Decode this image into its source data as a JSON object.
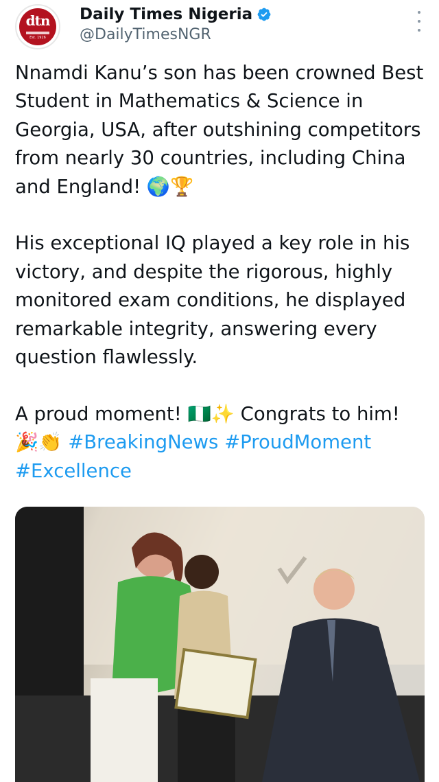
{
  "author": {
    "display_name": "Daily Times Nigeria",
    "handle": "@DailyTimesNGR",
    "avatar_mark": "dtn",
    "avatar_small_text": "Est. 1926",
    "verified_icon": "verified-badge-icon"
  },
  "tweet": {
    "paragraph_1": "Nnamdi Kanu’s son has been crowned Best Student in Mathematics & Science in Georgia, USA, after outshining competitors from nearly 30 countries, including China and England! 🌍🏆",
    "paragraph_2": "His exceptional IQ played a key role in his victory, and despite the rigorous, highly monitored exam conditions, he displayed remarkable integrity, answering every question flawlessly.",
    "paragraph_3_text": "A proud moment! 🇳🇬✨ Congrats to him! 🎉👏 ",
    "hashtags": [
      "#BreakingNews",
      "#ProudMoment",
      "#Excellence"
    ]
  },
  "media": {
    "type": "photo",
    "description_icon": "award-ceremony-photo"
  },
  "colors": {
    "link": "#1d9bf0",
    "text": "#0f1419",
    "secondary": "#536471",
    "verified": "#1d9bf0",
    "brand": "#b3121f"
  }
}
